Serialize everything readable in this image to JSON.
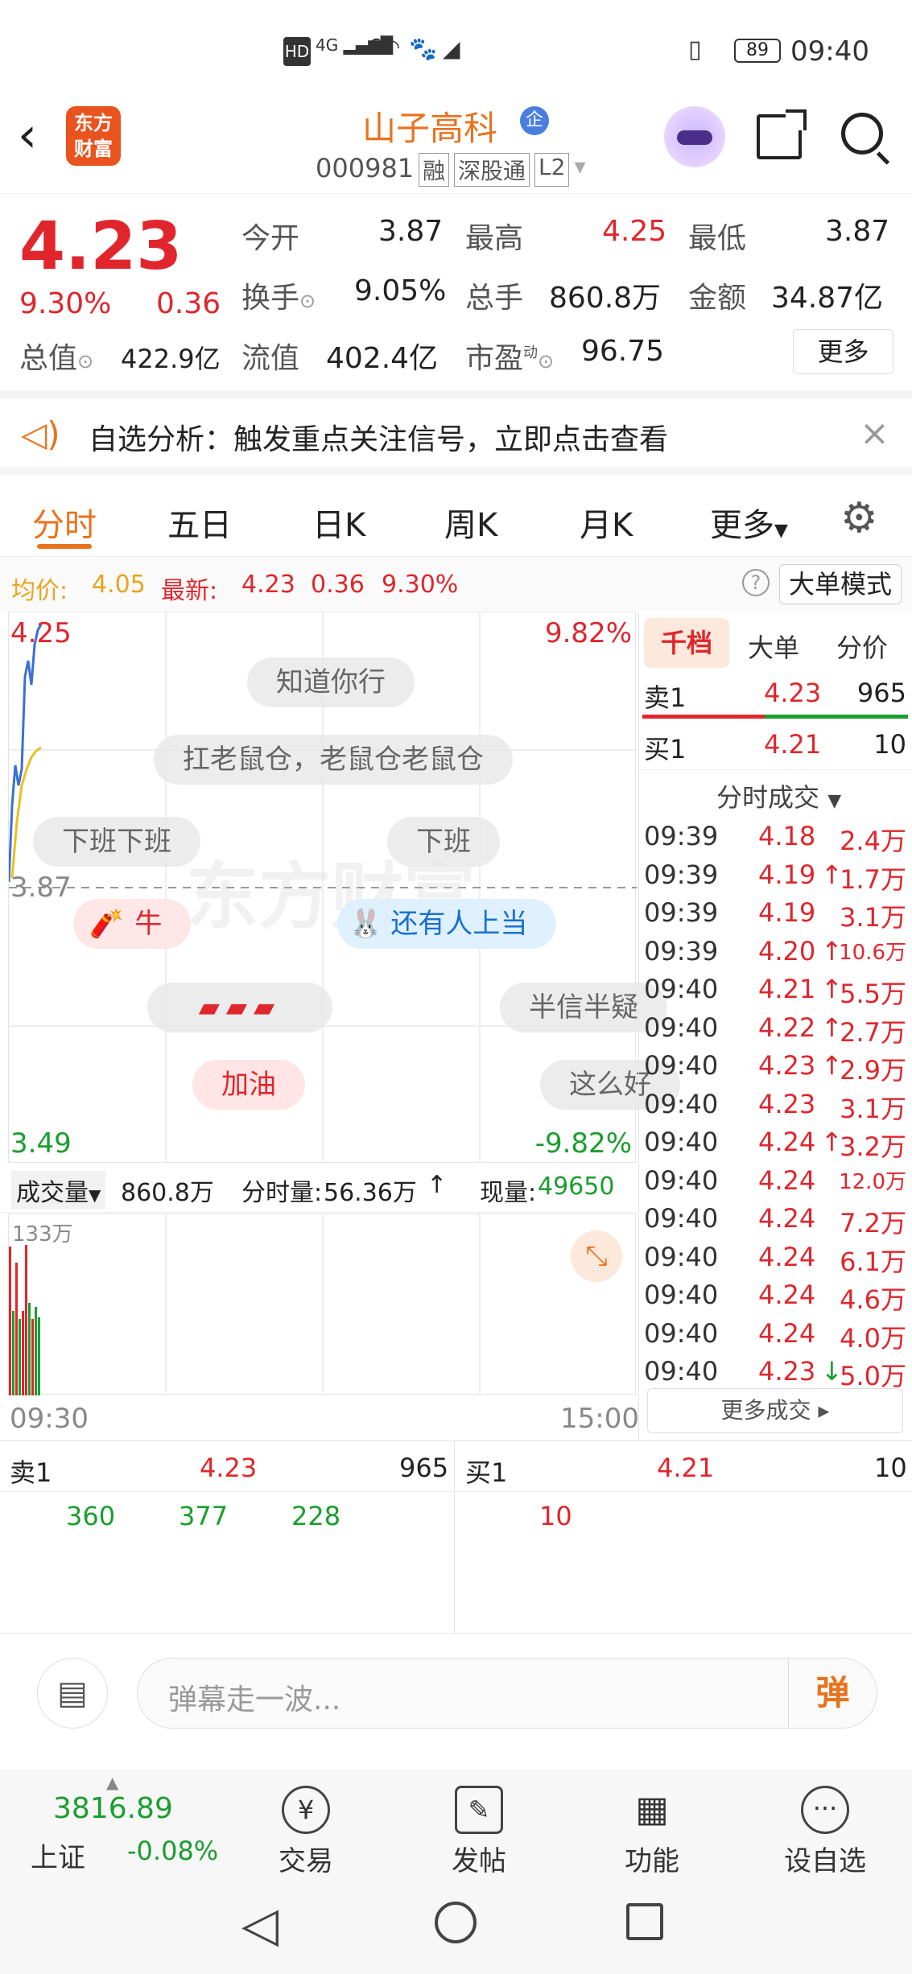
{
  "status_bar": {
    "icons_left": "HD 4G 6",
    "battery": "89",
    "time": "09:40"
  },
  "header": {
    "logo_line1": "东方",
    "logo_line2": "财富",
    "stock_name": "山子高科",
    "qi_badge": "企",
    "code": "000981",
    "tags": [
      "融",
      "深股通",
      "L2"
    ]
  },
  "quote": {
    "price": "4.23",
    "change_pct": "9.30%",
    "change": "0.36",
    "open_label": "今开",
    "open": "3.87",
    "high_label": "最高",
    "high": "4.25",
    "low_label": "最低",
    "low": "3.87",
    "turnover_label": "换手",
    "turnover": "9.05%",
    "volume_label": "总手",
    "volume": "860.8万",
    "amount_label": "金额",
    "amount": "34.87亿",
    "mktcap_label": "总值",
    "mktcap": "422.9亿",
    "float_label": "流值",
    "float": "402.4亿",
    "pe_label": "市盈",
    "pe_sup": "动",
    "pe": "96.75",
    "more_button": "更多"
  },
  "banner": {
    "text": "自选分析：触发重点关注信号，立即点击查看"
  },
  "tabs": {
    "items": [
      "分时",
      "五日",
      "日K",
      "周K",
      "月K",
      "更多"
    ],
    "active": "分时"
  },
  "avg_line": {
    "avg_label": "均价:",
    "avg": "4.05",
    "latest_label": "最新:",
    "latest": "4.23",
    "change": "0.36",
    "pct": "9.30%",
    "bigorder_button": "大单模式"
  },
  "chart": {
    "y_top": "4.25",
    "y_mid": "3.87",
    "y_bottom": "3.49",
    "pct_top": "9.82%",
    "pct_bottom": "-9.82%",
    "watermark": "东方财富",
    "danmu": [
      "知道你行",
      "扛老鼠仓，老鼠仓老鼠仓",
      "下班下班",
      "下班",
      "牛",
      "还有人上当",
      "半信半疑",
      "加油",
      "这么好"
    ]
  },
  "volume_bar": {
    "selector": "成交量",
    "total": "860.8万",
    "minute_label": "分时量:",
    "minute": "56.36万",
    "now_label": "现量:",
    "now": "49650",
    "scale": "133万"
  },
  "time_axis": {
    "start": "09:30",
    "end": "15:00"
  },
  "right_panel": {
    "tabs": [
      "千档",
      "大单",
      "分价"
    ],
    "sell1": {
      "label": "卖1",
      "price": "4.23",
      "qty": "965"
    },
    "buy1": {
      "label": "买1",
      "price": "4.21",
      "qty": "10"
    },
    "ticks_title": "分时成交",
    "ticks": [
      {
        "t": "09:39",
        "p": "4.18",
        "arrow": "",
        "v": "2.4万"
      },
      {
        "t": "09:39",
        "p": "4.19",
        "arrow": "↑",
        "v": "1.7万"
      },
      {
        "t": "09:39",
        "p": "4.19",
        "arrow": "",
        "v": "3.1万"
      },
      {
        "t": "09:39",
        "p": "4.20",
        "arrow": "↑",
        "v": "10.6万"
      },
      {
        "t": "09:40",
        "p": "4.21",
        "arrow": "↑",
        "v": "5.5万"
      },
      {
        "t": "09:40",
        "p": "4.22",
        "arrow": "↑",
        "v": "2.7万"
      },
      {
        "t": "09:40",
        "p": "4.23",
        "arrow": "↑",
        "v": "2.9万"
      },
      {
        "t": "09:40",
        "p": "4.23",
        "arrow": "",
        "v": "3.1万"
      },
      {
        "t": "09:40",
        "p": "4.24",
        "arrow": "↑",
        "v": "3.2万"
      },
      {
        "t": "09:40",
        "p": "4.24",
        "arrow": "",
        "v": "12.0万"
      },
      {
        "t": "09:40",
        "p": "4.24",
        "arrow": "",
        "v": "7.2万"
      },
      {
        "t": "09:40",
        "p": "4.24",
        "arrow": "",
        "v": "6.1万"
      },
      {
        "t": "09:40",
        "p": "4.24",
        "arrow": "",
        "v": "4.6万"
      },
      {
        "t": "09:40",
        "p": "4.24",
        "arrow": "",
        "v": "4.0万"
      },
      {
        "t": "09:40",
        "p": "4.23",
        "arrow": "↓",
        "v": "5.0万"
      }
    ],
    "more_ticks": "更多成交"
  },
  "depth": {
    "sell_label": "卖1",
    "sell_price": "4.23",
    "sell_qty": "965",
    "sell_orders": [
      "360",
      "377",
      "228"
    ],
    "buy_label": "买1",
    "buy_price": "4.21",
    "buy_qty": "10",
    "buy_orders": [
      "10"
    ]
  },
  "comment": {
    "placeholder": "弹幕走一波...",
    "send_label": "弹"
  },
  "bottom_nav": {
    "index_value": "3816.89",
    "index_name": "上证",
    "index_change": "-0.08%",
    "items": [
      "交易",
      "发帖",
      "功能",
      "设自选"
    ]
  },
  "colors": {
    "up": "#e0262c",
    "down": "#1a9e2e",
    "accent": "#e8731e"
  }
}
